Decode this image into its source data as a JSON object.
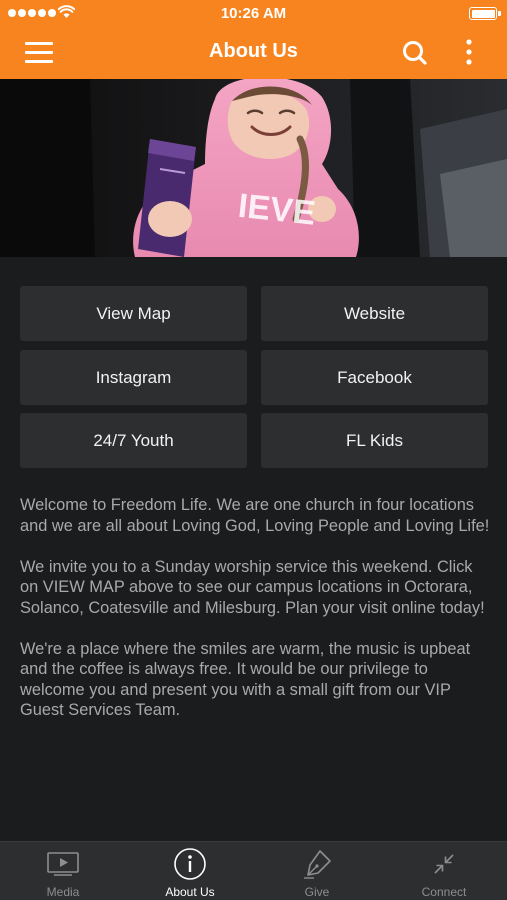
{
  "status_bar": {
    "time": "10:26 AM",
    "battery_level": 1.0
  },
  "app_bar": {
    "title": "About Us"
  },
  "icons": {
    "menu": "hamburger-menu-icon",
    "search": "search-icon",
    "more": "more-vertical-icon"
  },
  "buttons": [
    {
      "label": "View Map"
    },
    {
      "label": "Website"
    },
    {
      "label": "Instagram"
    },
    {
      "label": "Facebook"
    },
    {
      "label": "24/7 Youth"
    },
    {
      "label": "FL Kids"
    }
  ],
  "about": {
    "paragraphs": [
      "Welcome to Freedom Life. We are one church in four locations and we are all about Loving God, Loving People and Loving Life!",
      "We invite you to a Sunday worship service this weekend. Click on VIEW MAP above to see our campus locations in Octorara, Solanco, Coatesville and Milesburg. Plan your visit online today!",
      "We're a place where the smiles are warm, the music is upbeat and the coffee is always free. It would be our privilege to welcome you and present you with a small gift from our VIP Guest Services Team."
    ]
  },
  "tabs": [
    {
      "label": "Media",
      "icon": "video-play-icon",
      "active": false
    },
    {
      "label": "About Us",
      "icon": "info-icon",
      "active": true
    },
    {
      "label": "Give",
      "icon": "pen-nib-icon",
      "active": false
    },
    {
      "label": "Connect",
      "icon": "connect-arrows-icon",
      "active": false
    }
  ],
  "colors": {
    "accent": "#f7841f",
    "background": "#1b1c1e",
    "button": "#2d2e30",
    "body_text": "#a9a9a9"
  }
}
